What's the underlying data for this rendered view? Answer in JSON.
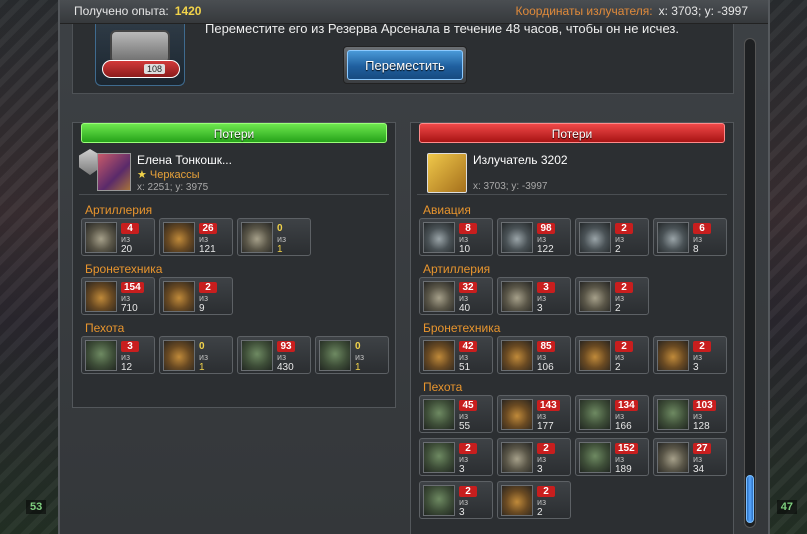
{
  "header": {
    "exp_label": "Получено опыта:",
    "exp_value": "1420",
    "coords_label": "Координаты излучателя:",
    "coords_value": "x: 3703; y: -3997"
  },
  "info": {
    "text": "Переместите его из Резерва Арсенала в течение 48 часов, чтобы он не исчез.",
    "robot_number": "108",
    "move_button": "Переместить"
  },
  "background": {
    "left_number": "53",
    "right_number": "47"
  },
  "left_panel": {
    "header": "Потери",
    "player": {
      "name": "Елена Тонкошк...",
      "city": "Черкассы",
      "coords": "x: 2251; y: 3975"
    },
    "sections": [
      {
        "title": "Артиллерия",
        "units": [
          {
            "lost": "4",
            "of": "из",
            "total": "20"
          },
          {
            "lost": "26",
            "of": "из",
            "total": "121"
          },
          {
            "lost": "0",
            "of": "из",
            "total": "1"
          }
        ]
      },
      {
        "title": "Бронетехника",
        "units": [
          {
            "lost": "154",
            "of": "из",
            "total": "710"
          },
          {
            "lost": "2",
            "of": "из",
            "total": "9"
          }
        ]
      },
      {
        "title": "Пехота",
        "units": [
          {
            "lost": "3",
            "of": "из",
            "total": "12"
          },
          {
            "lost": "0",
            "of": "из",
            "total": "1"
          },
          {
            "lost": "93",
            "of": "из",
            "total": "430"
          },
          {
            "lost": "0",
            "of": "из",
            "total": "1"
          }
        ]
      }
    ]
  },
  "right_panel": {
    "header": "Потери",
    "emitter": {
      "name": "Излучатель 3202",
      "coords": "x: 3703; y: -3997"
    },
    "sections": [
      {
        "title": "Авиация",
        "units": [
          {
            "lost": "8",
            "of": "из",
            "total": "10"
          },
          {
            "lost": "98",
            "of": "из",
            "total": "122"
          },
          {
            "lost": "2",
            "of": "из",
            "total": "2"
          },
          {
            "lost": "6",
            "of": "из",
            "total": "8"
          }
        ]
      },
      {
        "title": "Артиллерия",
        "units": [
          {
            "lost": "32",
            "of": "из",
            "total": "40"
          },
          {
            "lost": "3",
            "of": "из",
            "total": "3"
          },
          {
            "lost": "2",
            "of": "из",
            "total": "2"
          }
        ]
      },
      {
        "title": "Бронетехника",
        "units": [
          {
            "lost": "42",
            "of": "из",
            "total": "51"
          },
          {
            "lost": "85",
            "of": "из",
            "total": "106"
          },
          {
            "lost": "2",
            "of": "из",
            "total": "2"
          },
          {
            "lost": "2",
            "of": "из",
            "total": "3"
          }
        ]
      },
      {
        "title": "Пехота",
        "units": [
          {
            "lost": "45",
            "of": "из",
            "total": "55"
          },
          {
            "lost": "143",
            "of": "из",
            "total": "177"
          },
          {
            "lost": "134",
            "of": "из",
            "total": "166"
          },
          {
            "lost": "103",
            "of": "из",
            "total": "128"
          },
          {
            "lost": "2",
            "of": "из",
            "total": "3"
          },
          {
            "lost": "2",
            "of": "из",
            "total": "3"
          },
          {
            "lost": "152",
            "of": "из",
            "total": "189"
          },
          {
            "lost": "27",
            "of": "из",
            "total": "34"
          },
          {
            "lost": "2",
            "of": "из",
            "total": "3"
          },
          {
            "lost": "2",
            "of": "из",
            "total": "2"
          }
        ]
      }
    ]
  }
}
